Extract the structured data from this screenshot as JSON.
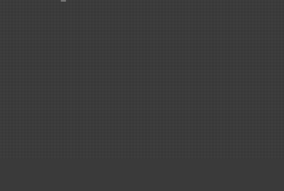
{
  "window": {
    "title": "",
    "background_color": "#3b3b3b"
  },
  "content": {
    "text": ""
  }
}
